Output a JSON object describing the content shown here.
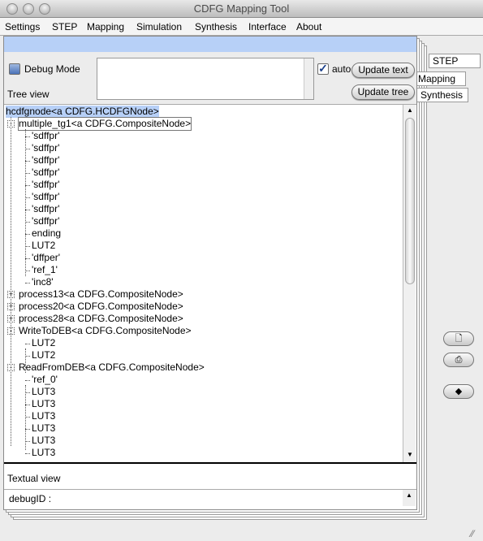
{
  "window": {
    "title": "CDFG Mapping Tool"
  },
  "menu": [
    "Settings",
    "STEP",
    "Mapping",
    "Simulation",
    "Synthesis",
    "Interface",
    "About"
  ],
  "controls": {
    "debug_mode_label": "Debug Mode",
    "debug_mode_checked": false,
    "auto_label": "auto",
    "auto_checked": true,
    "update_text": "Update text",
    "update_tree": "Update tree",
    "tree_view_label": "Tree view",
    "textual_view_label": "Textual view",
    "debug_id": "debugID :"
  },
  "tabs": [
    "STEP",
    "Mapping",
    "Synthesis"
  ],
  "tree": [
    {
      "text": "hcdfgnode<a CDFG.HCDFGNode>",
      "level": 0,
      "selected": true
    },
    {
      "text": "multiple_tg1<a CDFG.CompositeNode>",
      "level": 1,
      "expander": "-",
      "focused": true
    },
    {
      "text": "'sdffpr'",
      "level": 2
    },
    {
      "text": "'sdffpr'",
      "level": 2
    },
    {
      "text": "'sdffpr'",
      "level": 2
    },
    {
      "text": "'sdffpr'",
      "level": 2
    },
    {
      "text": "'sdffpr'",
      "level": 2
    },
    {
      "text": "'sdffpr'",
      "level": 2
    },
    {
      "text": "'sdffpr'",
      "level": 2
    },
    {
      "text": "'sdffpr'",
      "level": 2
    },
    {
      "text": "ending",
      "level": 2
    },
    {
      "text": "LUT2",
      "level": 2
    },
    {
      "text": "'dffper'",
      "level": 2
    },
    {
      "text": "'ref_1'",
      "level": 2
    },
    {
      "text": "'inc8'",
      "level": 2
    },
    {
      "text": "process13<a CDFG.CompositeNode>",
      "level": 1,
      "expander": "+"
    },
    {
      "text": "process20<a CDFG.CompositeNode>",
      "level": 1,
      "expander": "+"
    },
    {
      "text": "process28<a CDFG.CompositeNode>",
      "level": 1,
      "expander": "+"
    },
    {
      "text": "WriteToDEB<a CDFG.CompositeNode>",
      "level": 1,
      "expander": "-"
    },
    {
      "text": "LUT2",
      "level": 2
    },
    {
      "text": "LUT2",
      "level": 2
    },
    {
      "text": "ReadFromDEB<a CDFG.CompositeNode>",
      "level": 1,
      "expander": "-"
    },
    {
      "text": "'ref_0'",
      "level": 2
    },
    {
      "text": "LUT3",
      "level": 2
    },
    {
      "text": "LUT3",
      "level": 2
    },
    {
      "text": "LUT3",
      "level": 2
    },
    {
      "text": "LUT3",
      "level": 2
    },
    {
      "text": "LUT3",
      "level": 2
    },
    {
      "text": "LUT3",
      "level": 2
    }
  ],
  "side_icons": [
    "new-document-icon",
    "print-icon",
    "erase-icon"
  ],
  "colors": {
    "selection": "#b7d0f7",
    "header_strip": "#b7d0f7"
  }
}
